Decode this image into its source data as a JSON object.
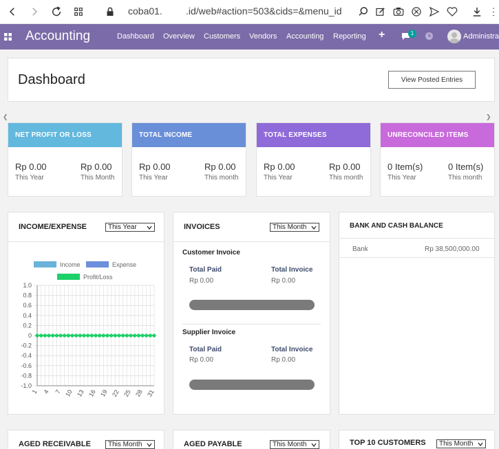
{
  "browser": {
    "url_left": "coba01.",
    "url_right": ".id/web#action=503&cids=&menu_id"
  },
  "app": {
    "title": "Accounting",
    "nav": [
      "Dashboard",
      "Overview",
      "Customers",
      "Vendors",
      "Accounting",
      "Reporting"
    ],
    "plus": "+",
    "chat_badge": "1",
    "user": "Administrator"
  },
  "dashboard": {
    "title": "Dashboard",
    "posted_button": "View Posted Entries"
  },
  "kpis": [
    {
      "title": "NET PROFIT OR LOSS",
      "color": "#63b8dd",
      "left_value": "Rp 0.00",
      "left_label": "This Year",
      "right_value": "Rp 0.00",
      "right_label": "This Month"
    },
    {
      "title": "TOTAL INCOME",
      "color": "#6a8fd9",
      "left_value": "Rp 0.00",
      "left_label": "This Year",
      "right_value": "Rp 0.00",
      "right_label": "This month"
    },
    {
      "title": "TOTAL EXPENSES",
      "color": "#8f6ad9",
      "left_value": "Rp 0.00",
      "left_label": "This Year",
      "right_value": "Rp 0.00",
      "right_label": "This month"
    },
    {
      "title": "UNRECONCILED ITEMS",
      "color": "#c86adb",
      "left_value": "0 Item(s)",
      "left_label": "This Year",
      "right_value": "0 Item(s)",
      "right_label": "This month"
    }
  ],
  "income_expense": {
    "title": "INCOME/EXPENSE",
    "filter": "This Year"
  },
  "invoices": {
    "title": "INVOICES",
    "filter": "This Month",
    "customer": {
      "heading": "Customer Invoice",
      "paid_label": "Total Paid",
      "paid_value": "Rp 0.00",
      "invoice_label": "Total Invoice",
      "invoice_value": "Rp 0.00"
    },
    "supplier": {
      "heading": "Supplier Invoice",
      "paid_label": "Total Paid",
      "paid_value": "Rp 0.00",
      "invoice_label": "Total Invoice",
      "invoice_value": "Rp 0.00"
    }
  },
  "bank": {
    "title": "BANK AND CASH BALANCE",
    "rows": [
      {
        "name": "Bank",
        "value": "Rp 38,500,000.00"
      }
    ]
  },
  "bottom": {
    "aged_receivable": {
      "title": "AGED RECEIVABLE",
      "filter": "This Month"
    },
    "aged_payable": {
      "title": "AGED PAYABLE",
      "filter": "This Month"
    },
    "top_customers": {
      "title": "TOP 10 CUSTOMERS",
      "filter": "This Month"
    }
  },
  "chart_data": {
    "type": "line",
    "title": "",
    "xlabel": "",
    "ylabel": "",
    "legend": [
      "Income",
      "Expense",
      "Profit/Loss"
    ],
    "legend_colors": [
      "#6bb3d9",
      "#6e8fdb",
      "#1ed068"
    ],
    "legend_placement": "top",
    "x_ticks": [
      1,
      4,
      7,
      10,
      13,
      16,
      19,
      22,
      25,
      28,
      31
    ],
    "y_ticks": [
      "1.0",
      "0.8",
      "0.6",
      "0.4",
      "0.2",
      "0",
      "-0.2",
      "-0.4",
      "-0.6",
      "-0.8",
      "-1.0"
    ],
    "ylim": [
      -1.0,
      1.0
    ],
    "x": [
      1,
      2,
      3,
      4,
      5,
      6,
      7,
      8,
      9,
      10,
      11,
      12,
      13,
      14,
      15,
      16,
      17,
      18,
      19,
      20,
      21,
      22,
      23,
      24,
      25,
      26,
      27,
      28,
      29,
      30,
      31
    ],
    "series": [
      {
        "name": "Profit/Loss",
        "values": [
          0,
          0,
          0,
          0,
          0,
          0,
          0,
          0,
          0,
          0,
          0,
          0,
          0,
          0,
          0,
          0,
          0,
          0,
          0,
          0,
          0,
          0,
          0,
          0,
          0,
          0,
          0,
          0,
          0,
          0,
          0
        ]
      }
    ],
    "grid": true
  }
}
